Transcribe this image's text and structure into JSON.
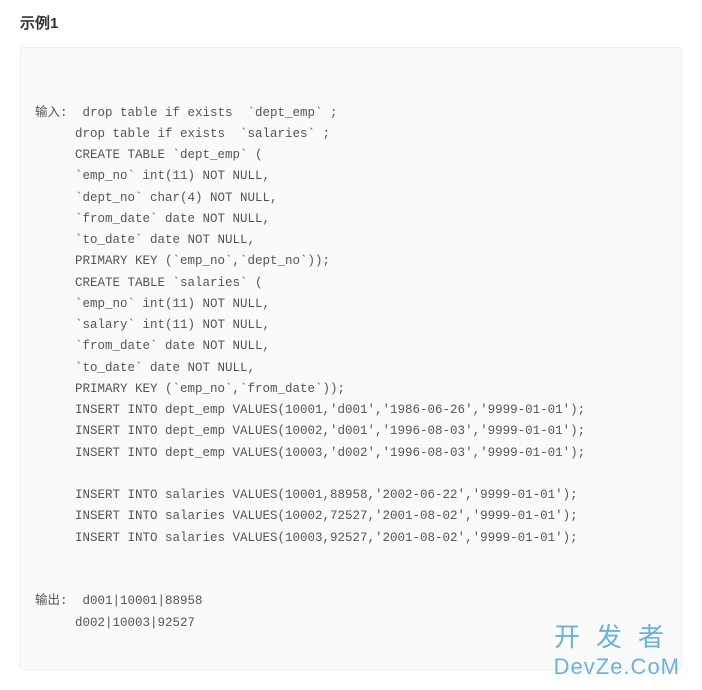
{
  "heading": "示例1",
  "labels": {
    "input": "输入:",
    "output": "输出:"
  },
  "input_lines": [
    "drop table if exists  `dept_emp` ;",
    "drop table if exists  `salaries` ;",
    "CREATE TABLE `dept_emp` (",
    "`emp_no` int(11) NOT NULL,",
    "`dept_no` char(4) NOT NULL,",
    "`from_date` date NOT NULL,",
    "`to_date` date NOT NULL,",
    "PRIMARY KEY (`emp_no`,`dept_no`));",
    "CREATE TABLE `salaries` (",
    "`emp_no` int(11) NOT NULL,",
    "`salary` int(11) NOT NULL,",
    "`from_date` date NOT NULL,",
    "`to_date` date NOT NULL,",
    "PRIMARY KEY (`emp_no`,`from_date`));",
    "INSERT INTO dept_emp VALUES(10001,'d001','1986-06-26','9999-01-01');",
    "INSERT INTO dept_emp VALUES(10002,'d001','1996-08-03','9999-01-01');",
    "INSERT INTO dept_emp VALUES(10003,'d002','1996-08-03','9999-01-01');",
    "",
    "INSERT INTO salaries VALUES(10001,88958,'2002-06-22','9999-01-01');",
    "INSERT INTO salaries VALUES(10002,72527,'2001-08-02','9999-01-01');",
    "INSERT INTO salaries VALUES(10003,92527,'2001-08-02','9999-01-01');"
  ],
  "output_lines": [
    "d001|10001|88958",
    "d002|10003|92527"
  ],
  "watermark": {
    "line1": "开发者",
    "line2": "DevZe.CoM"
  }
}
